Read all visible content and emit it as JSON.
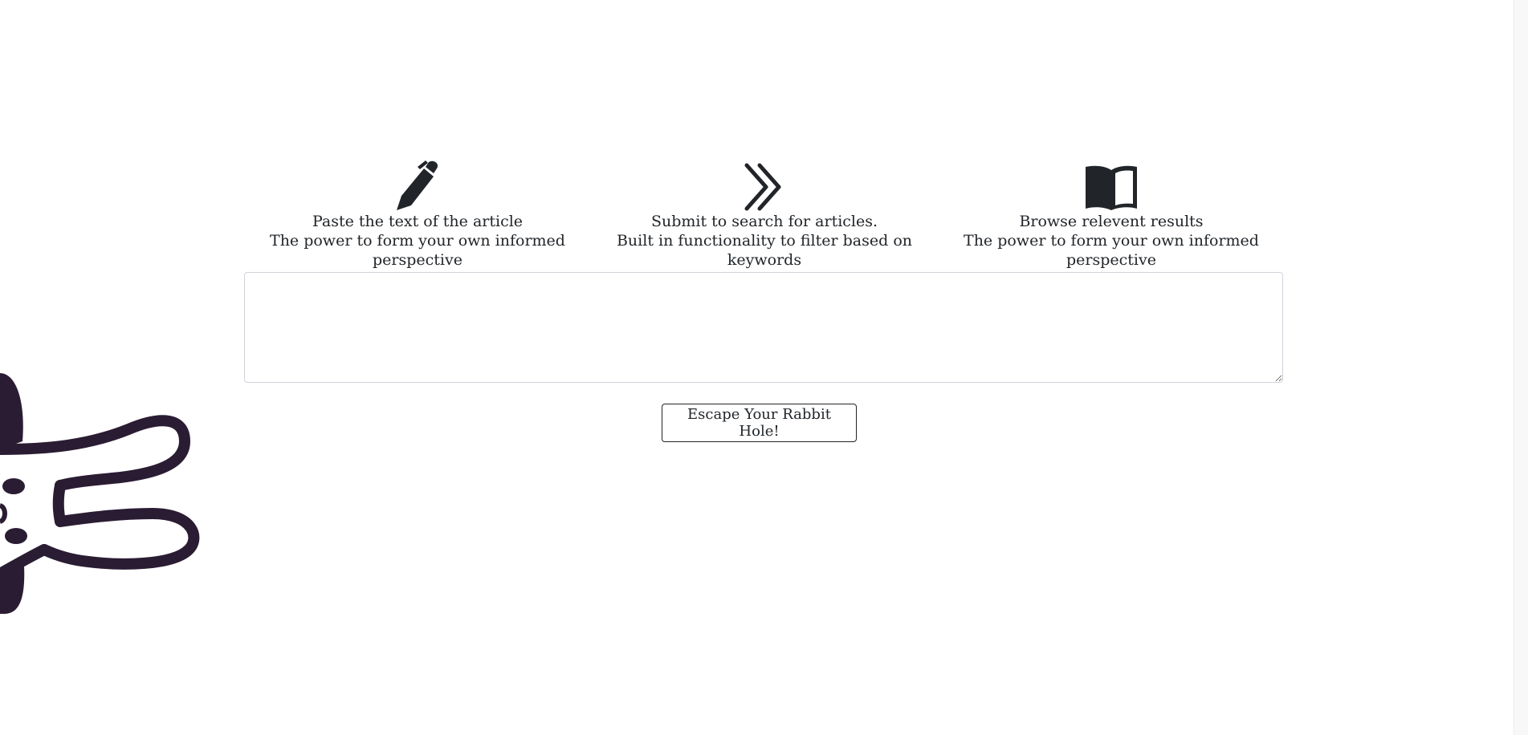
{
  "steps": [
    {
      "icon": "pen-icon",
      "title": "Paste the text of the article",
      "description": "The power to form your own informed perspective"
    },
    {
      "icon": "double-chevron-right-icon",
      "title": "Submit to search for articles.",
      "description": "Built in functionality to filter based on keywords"
    },
    {
      "icon": "open-book-icon",
      "title": "Browse relevent results",
      "description": "The power to form your own informed perspective"
    }
  ],
  "article_input": {
    "value": "",
    "placeholder": ""
  },
  "submit_button": {
    "label": "Escape Your Rabbit Hole!"
  },
  "colors": {
    "text": "#212529",
    "rabbit": "#2a1c33",
    "border": "#cfd4da"
  }
}
